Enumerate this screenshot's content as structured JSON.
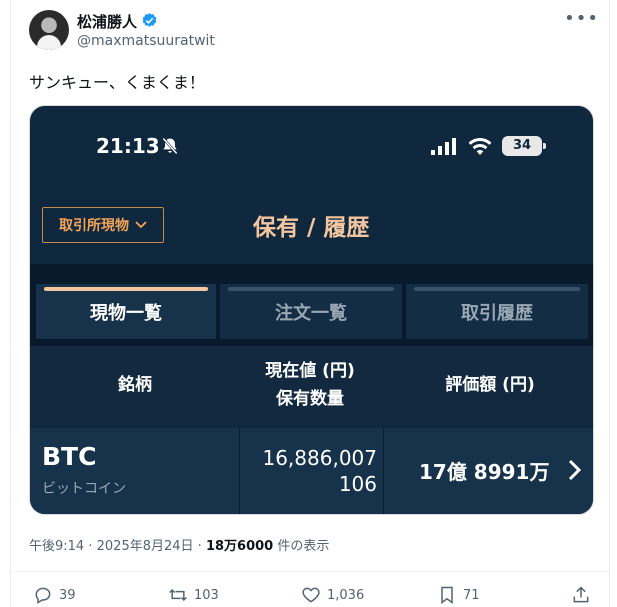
{
  "author": {
    "name": "松浦勝人",
    "handle": "@maxmatsuuratwit",
    "more_label": "•••"
  },
  "tweet": {
    "text": "サンキュー、くまくま！"
  },
  "screenshot": {
    "status": {
      "time": "21:13",
      "battery": "34"
    },
    "exchange_selector": {
      "label": "取引所現物",
      "chevron": "chevron-down-icon"
    },
    "page_title": "保有 / 履歴",
    "tabs": [
      {
        "label": "現物一覧",
        "active": true
      },
      {
        "label": "注文一覧"
      },
      {
        "label": "取引履歴"
      }
    ],
    "columns": {
      "symbol": "銘柄",
      "current_value": "現在値 (円)",
      "quantity": "保有数量",
      "valuation": "評価額 (円)"
    },
    "row": {
      "ticker": "BTC",
      "kana": "ビットコイン",
      "price": "16,886,007",
      "quantity": "106",
      "valuation": "17億 8991万"
    }
  },
  "meta": {
    "time": "午後9:14",
    "date": "2025年8月24日",
    "views": "18万6000",
    "views_label": "件の表示",
    "separator": "·"
  },
  "actions": {
    "replies": "39",
    "retweets": "103",
    "likes": "1,036",
    "bookmarks": "71"
  },
  "colors": {
    "brand_blue": "#1d9bf0",
    "dark_panel": "#10283d",
    "accent_orange": "#f3a458"
  }
}
